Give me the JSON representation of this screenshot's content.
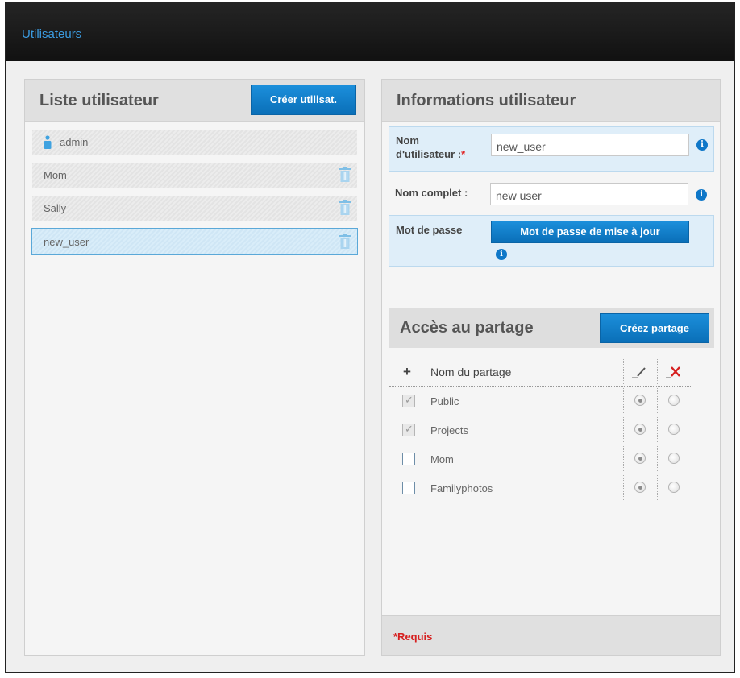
{
  "topbar": {
    "title": "Utilisateurs"
  },
  "user_list": {
    "title": "Liste utilisateur",
    "create_button": "Créer utilisat.",
    "users": [
      {
        "name": "admin",
        "icon": "person-icon"
      },
      {
        "name": "Mom",
        "icon": "trash-icon"
      },
      {
        "name": "Sally",
        "icon": "trash-icon"
      },
      {
        "name": "new_user",
        "icon": "trash-icon",
        "selected": true
      }
    ]
  },
  "user_info": {
    "title": "Informations utilisateur",
    "username_label_1": "Nom",
    "username_label_2": "d'utilisateur :",
    "required_star": "*",
    "username_value": "new_user",
    "fullname_label": "Nom complet :",
    "fullname_value": "new user",
    "password_label": "Mot de passe",
    "password_button": "Mot de passe de mise à jour",
    "info_glyph": "i"
  },
  "share_access": {
    "title": "Accès au partage",
    "create_button": "Créez partage",
    "plus_glyph": "+",
    "column_name": "Nom du partage",
    "rows": [
      {
        "name": "Public",
        "checked": true,
        "rw": true,
        "none": false
      },
      {
        "name": "Projects",
        "checked": true,
        "rw": true,
        "none": false
      },
      {
        "name": "Mom",
        "checked": false,
        "rw": true,
        "none": false
      },
      {
        "name": "Familyphotos",
        "checked": false,
        "rw": true,
        "none": false
      }
    ]
  },
  "footer": {
    "required_note": "*Requis"
  },
  "colors": {
    "accent": "#0a6fb8",
    "title_blue": "#3b9be0",
    "required_red": "#d62020"
  }
}
